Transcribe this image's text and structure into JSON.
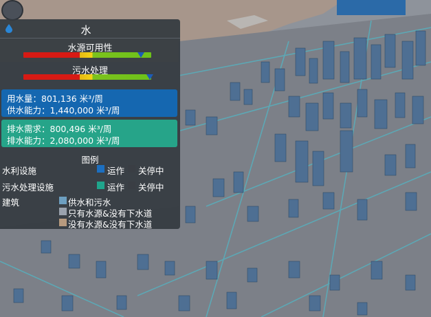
{
  "panel": {
    "title": "水",
    "icon": "water-drop-icon",
    "water_availability": {
      "label": "水源可用性",
      "level": 0.92
    },
    "sewage": {
      "label": "污水处理",
      "level": 0.99
    },
    "water_stats": {
      "consumption": "用水量：801,136 米³/周",
      "capacity": "供水能力：1,440,000 米³/周",
      "color": "#1567b0"
    },
    "sewage_stats": {
      "demand": "排水需求：800,496 米³/周",
      "capacity": "排水能力：2,080,000 米³/周",
      "color": "#26a489"
    },
    "legend": {
      "title": "图例",
      "water_facility": "水利设施",
      "sewage_facility": "污水处理设施",
      "operating": "运作",
      "stopped": "关停中",
      "buildings": "建筑",
      "both": "供水和污水",
      "water_only": "只有水源&没有下水道",
      "none": "没有水源&没有下水道",
      "colors": {
        "water_op": "#1c6fc0",
        "sewage_op": "#1fa58c",
        "stopped": "#3a3e44",
        "both": "#6d9fc0",
        "water_only": "#9aa2ad",
        "none": "#b79a7e"
      }
    }
  }
}
